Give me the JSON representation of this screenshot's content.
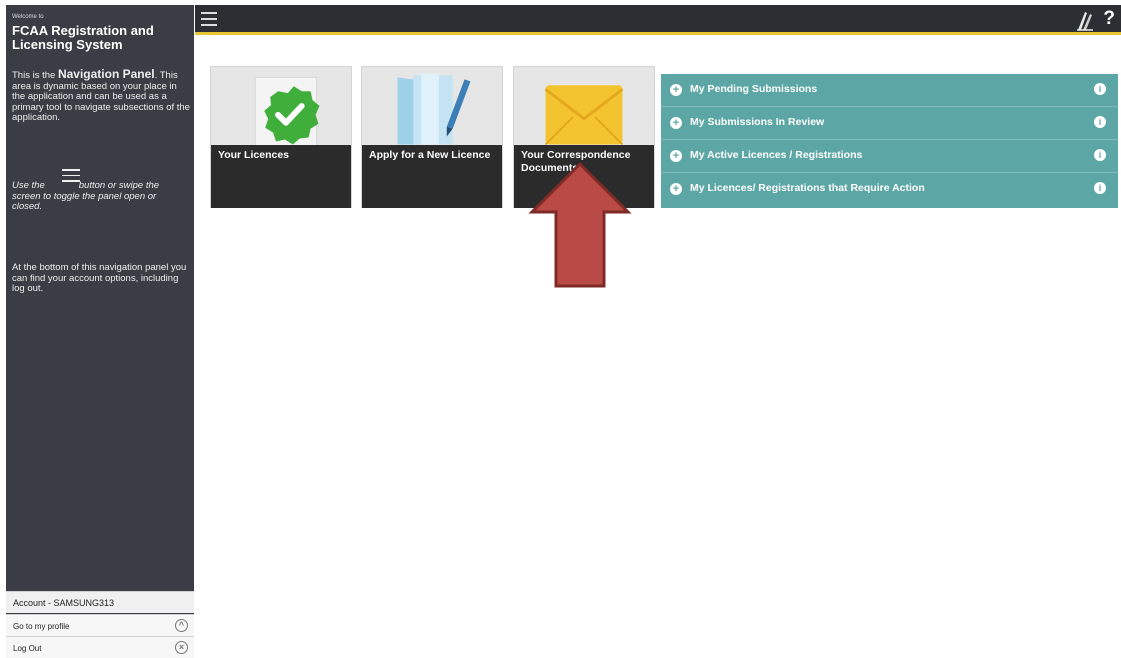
{
  "sidebar": {
    "welcome": "Welcome to",
    "app_title": "FCAA Registration and Licensing System",
    "nav_intro": "This is the ",
    "nav_bold": "Navigation Panel",
    "nav_rest": ". This area is dynamic based on your place in the application and can be used as a primary tool to navigate subsections of the application.",
    "toggle_prefix": "Use the",
    "toggle_suffix": "button or swipe the screen to toggle the panel open or closed.",
    "bottom_desc": "At the bottom of this navigation panel you can find your account options, including log out.",
    "account_label": "Account - SAMSUNG313",
    "profile_label": "Go to my profile",
    "logout_label": "Log Out"
  },
  "topbar": {
    "help": "?"
  },
  "tiles": [
    {
      "label": "Your Licences",
      "icon": "checkmark-badge-icon"
    },
    {
      "label": "Apply for a New Licence",
      "icon": "folder-pen-icon"
    },
    {
      "label": "Your Correspondence Documents",
      "icon": "envelope-icon"
    }
  ],
  "accordion": [
    {
      "label": "My Pending Submissions"
    },
    {
      "label": "My Submissions In Review"
    },
    {
      "label": "My Active Licences / Registrations"
    },
    {
      "label": "My Licences/ Registrations that Require Action"
    }
  ],
  "colors": {
    "sidebar": "#3a3e44",
    "topbar": "#2b2e33",
    "accent_yellow": "#e7c533",
    "teal": "#5ca7a6",
    "arrow": "#b94a46"
  }
}
